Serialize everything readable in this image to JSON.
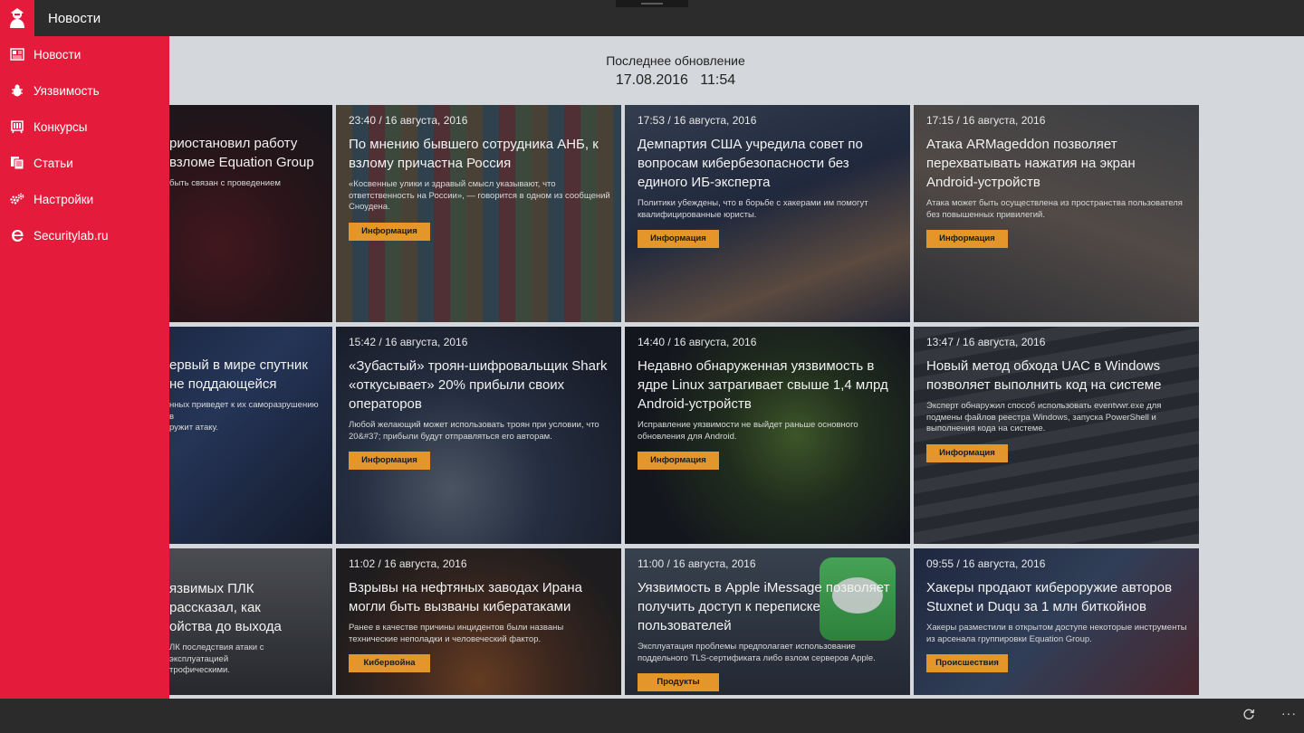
{
  "window": {
    "title": "Новости"
  },
  "sidebar": {
    "items": [
      {
        "label": "Новости",
        "icon": "newspaper-icon"
      },
      {
        "label": "Уязвимость",
        "icon": "bug-icon"
      },
      {
        "label": "Конкурсы",
        "icon": "contest-icon"
      },
      {
        "label": "Статьи",
        "icon": "documents-icon"
      },
      {
        "label": "Настройки",
        "icon": "gears-icon"
      },
      {
        "label": "Securitylab.ru",
        "icon": "browser-e-icon"
      }
    ]
  },
  "header": {
    "last_update_label": "Последнее обновление",
    "last_update_value": "17.08.2016   11:54"
  },
  "news": [
    {
      "time": "",
      "title": "риостановил работу\nвзломе Equation Group",
      "desc": "быть связан с проведением",
      "tag": ""
    },
    {
      "time": "23:40 / 16 августа, 2016",
      "title": "По мнению бывшего сотрудника АНБ, к взлому причастна Россия",
      "desc": "«Косвенные улики и здравый смысл указывают, что ответственность на России», — говорится в одном из сообщений Сноудена.",
      "tag": "Информация"
    },
    {
      "time": "17:53 / 16 августа, 2016",
      "title": "Демпартия США учредила совет по вопросам кибербезопасности без единого ИБ-эксперта",
      "desc": "Политики убеждены, что в борьбе с хакерами им помогут квалифицированные юристы.",
      "tag": "Информация"
    },
    {
      "time": "17:15 / 16 августа, 2016",
      "title": "Атака ARMageddon позволяет перехватывать нажатия на экран Android-устройств",
      "desc": "Атака может быть осуществлена из пространства пользователя без повышенных привилегий.",
      "tag": "Информация"
    },
    {
      "time": "",
      "title": "ервый в мире спутник\nне поддающейся",
      "desc": "нных приведет к их саморазрушению в\nружит атаку.",
      "tag": ""
    },
    {
      "time": "15:42 / 16 августа, 2016",
      "title": "«Зубастый» троян-шифровальщик Shark «откусывает» 20% прибыли своих операторов",
      "desc": "Любой желающий может использовать троян при условии, что 20&#37; прибыли будут отправляться его авторам.",
      "tag": "Информация"
    },
    {
      "time": "14:40 / 16 августа, 2016",
      "title": "Недавно обнаруженная уязвимость в ядре Linux затрагивает свыше 1,4 млрд Android-устройств",
      "desc": "Исправление уязвимости не выйдет раньше основного обновления для Android.",
      "tag": "Информация"
    },
    {
      "time": "13:47 / 16 августа, 2016",
      "title": "Новый метод обхода UAC в Windows позволяет выполнить код на системе",
      "desc": "Эксперт обнаружил способ использовать eventvwr.exe для подмены файлов реестра Windows, запуска PowerShell и выполнения кода на системе.",
      "tag": "Информация"
    },
    {
      "time": "",
      "title": "язвимых ПЛК\nрассказал, как\nойства до выхода",
      "desc": "ЛК последствия атаки с эксплуатацией\nтрофическими.",
      "tag": ""
    },
    {
      "time": "11:02 / 16 августа, 2016",
      "title": "Взрывы на нефтяных заводах Ирана могли быть вызваны кибератаками",
      "desc": "Ранее в качестве причины инцидентов были названы технические неполадки и человеческий фактор.",
      "tag": "Кибервойна"
    },
    {
      "time": "11:00 / 16 августа, 2016",
      "title": "Уязвимость в Apple iMessage позволяет получить доступ к переписке пользователей",
      "desc": "Эксплуатация проблемы предполагает использование поддельного TLS-сертификата либо взлом серверов Apple.",
      "tag": "Продукты"
    },
    {
      "time": "09:55 / 16 августа, 2016",
      "title": "Хакеры продают кибероружие авторов Stuxnet и Duqu за 1 млн биткойнов",
      "desc": "Хакеры разместили в открытом доступе некоторые инструменты из арсенала группировки Equation Group.",
      "tag": "Происшествия"
    }
  ],
  "bottombar": {
    "refresh_icon": "refresh-icon",
    "more_label": "···"
  },
  "colors": {
    "accent": "#e51b3b",
    "tag": "#e4962a",
    "titlebar": "#2c2c2c",
    "page_bg": "#d4d7db"
  }
}
